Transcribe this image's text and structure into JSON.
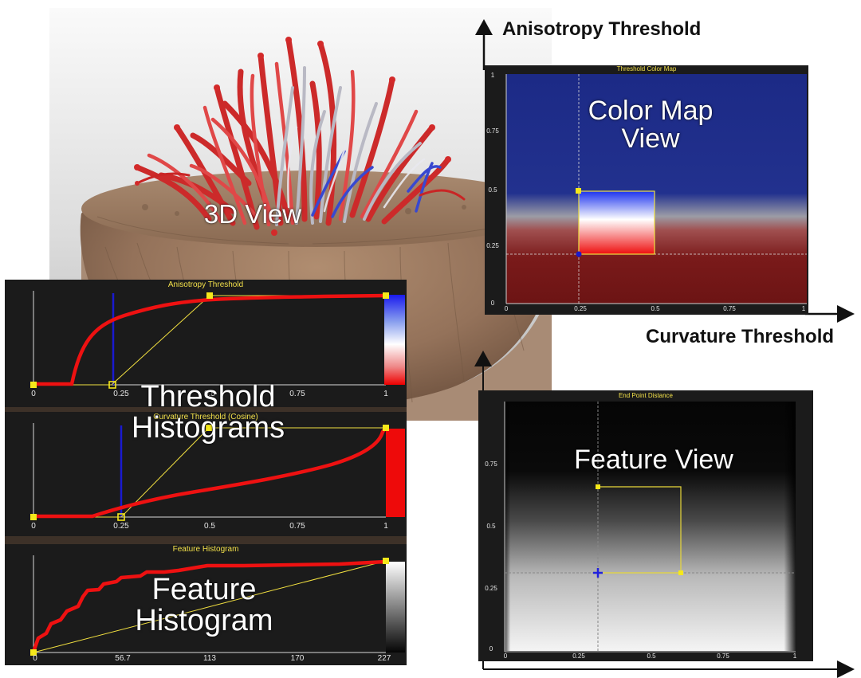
{
  "labels": {
    "view3d": "3D View",
    "threshold_histograms": [
      "Threshold",
      "Histograms"
    ],
    "feature_histogram": [
      "Feature",
      "Histogram"
    ],
    "color_map_view": [
      "Color Map",
      "View"
    ],
    "feature_view": "Feature View",
    "anisotropy_axis": "Anisotropy Threshold",
    "curvature_axis": "Curvature Threshold"
  },
  "panels": {
    "anisotropy_hist": {
      "title": "Anisotropy Threshold",
      "ticks": [
        "0",
        "0.25",
        "0.5",
        "0.75",
        "1"
      ]
    },
    "curvature_hist": {
      "title": "Curvature Threshold (Cosine)",
      "ticks": [
        "0",
        "0.25",
        "0.5",
        "0.75",
        "1"
      ]
    },
    "feature_hist": {
      "title": "Feature Histogram",
      "ticks": [
        "0",
        "56.7",
        "113",
        "170",
        "227"
      ]
    },
    "color_map": {
      "title": "Threshold Color Map",
      "xticks": [
        "0",
        "0.25",
        "0.5",
        "0.75",
        "1"
      ],
      "yticks": [
        "1",
        "0.75",
        "0.5",
        "0.25",
        "0"
      ]
    },
    "feature_view": {
      "title": "End Point Distance",
      "xticks": [
        "0",
        "0.25",
        "0.5",
        "0.75",
        "1"
      ],
      "yticks": [
        "0.75",
        "0.5",
        "0.25",
        "0"
      ]
    }
  },
  "colors": {
    "curve": "#ee1111",
    "handle": "#f5e81a",
    "marker": "#1a1acc",
    "panel_bg": "#1b1b1b",
    "deep_blue": "#1c2a86",
    "deep_red": "#761616"
  }
}
